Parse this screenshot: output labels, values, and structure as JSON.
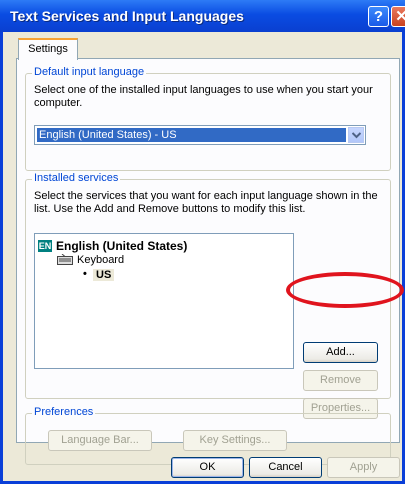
{
  "window": {
    "title": "Text Services and Input Languages",
    "help_glyph": "?",
    "close_glyph": "✕"
  },
  "tabs": [
    {
      "label": "Settings",
      "active": true
    }
  ],
  "default_input": {
    "legend": "Default input language",
    "description_line1": "Select one of the installed input languages to use when you start your",
    "description_line2": "computer.",
    "selected_value": "English (United States) - US"
  },
  "installed_services": {
    "legend": "Installed services",
    "description_line1": "Select the services that you want for each input language shown in the",
    "description_line2": "list. Use the Add and Remove buttons to modify this list.",
    "tree": {
      "language_badge": "EN",
      "language": "English (United States)",
      "category": "Keyboard",
      "bullet": "•",
      "layout": "US"
    },
    "buttons": {
      "add": "Add...",
      "remove": "Remove",
      "properties": "Properties..."
    }
  },
  "preferences": {
    "legend": "Preferences",
    "language_bar": "Language Bar...",
    "key_settings": "Key Settings..."
  },
  "footer": {
    "ok": "OK",
    "cancel": "Cancel",
    "apply": "Apply"
  },
  "colors": {
    "title_bar": "#0a4ce2",
    "dialog_face": "#ece9d8",
    "legend_text": "#0046d5",
    "selection": "#316ac5",
    "highlight_circle": "#e0141e"
  }
}
